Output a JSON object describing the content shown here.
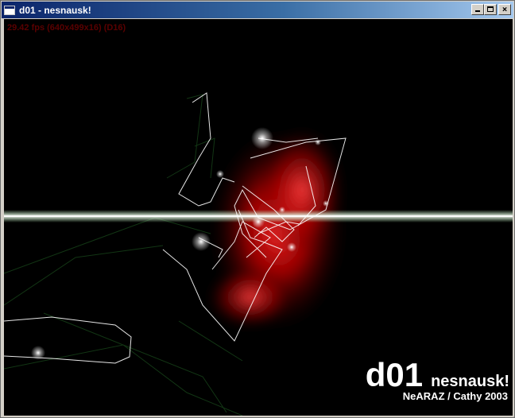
{
  "window": {
    "title": "d01 - nesnausk!",
    "buttons": {
      "minimize_icon": "minimize-icon",
      "maximize_icon": "maximize-icon",
      "close_icon": "close-icon",
      "close_glyph": "×"
    }
  },
  "demo": {
    "fps_text": "29.42 fps (640x499x16) (D16)",
    "title": "d01",
    "group": "nesnausk!",
    "credits": "NeARAZ / Cathy 2003"
  },
  "colors": {
    "titlebar_start": "#0a246a",
    "titlebar_end": "#a6caf0",
    "background": "#000000",
    "glow_red": "#ff1a1a",
    "line_white": "#ffffff",
    "grid_green": "#1f5a22",
    "fps_text": "#5a0000"
  }
}
